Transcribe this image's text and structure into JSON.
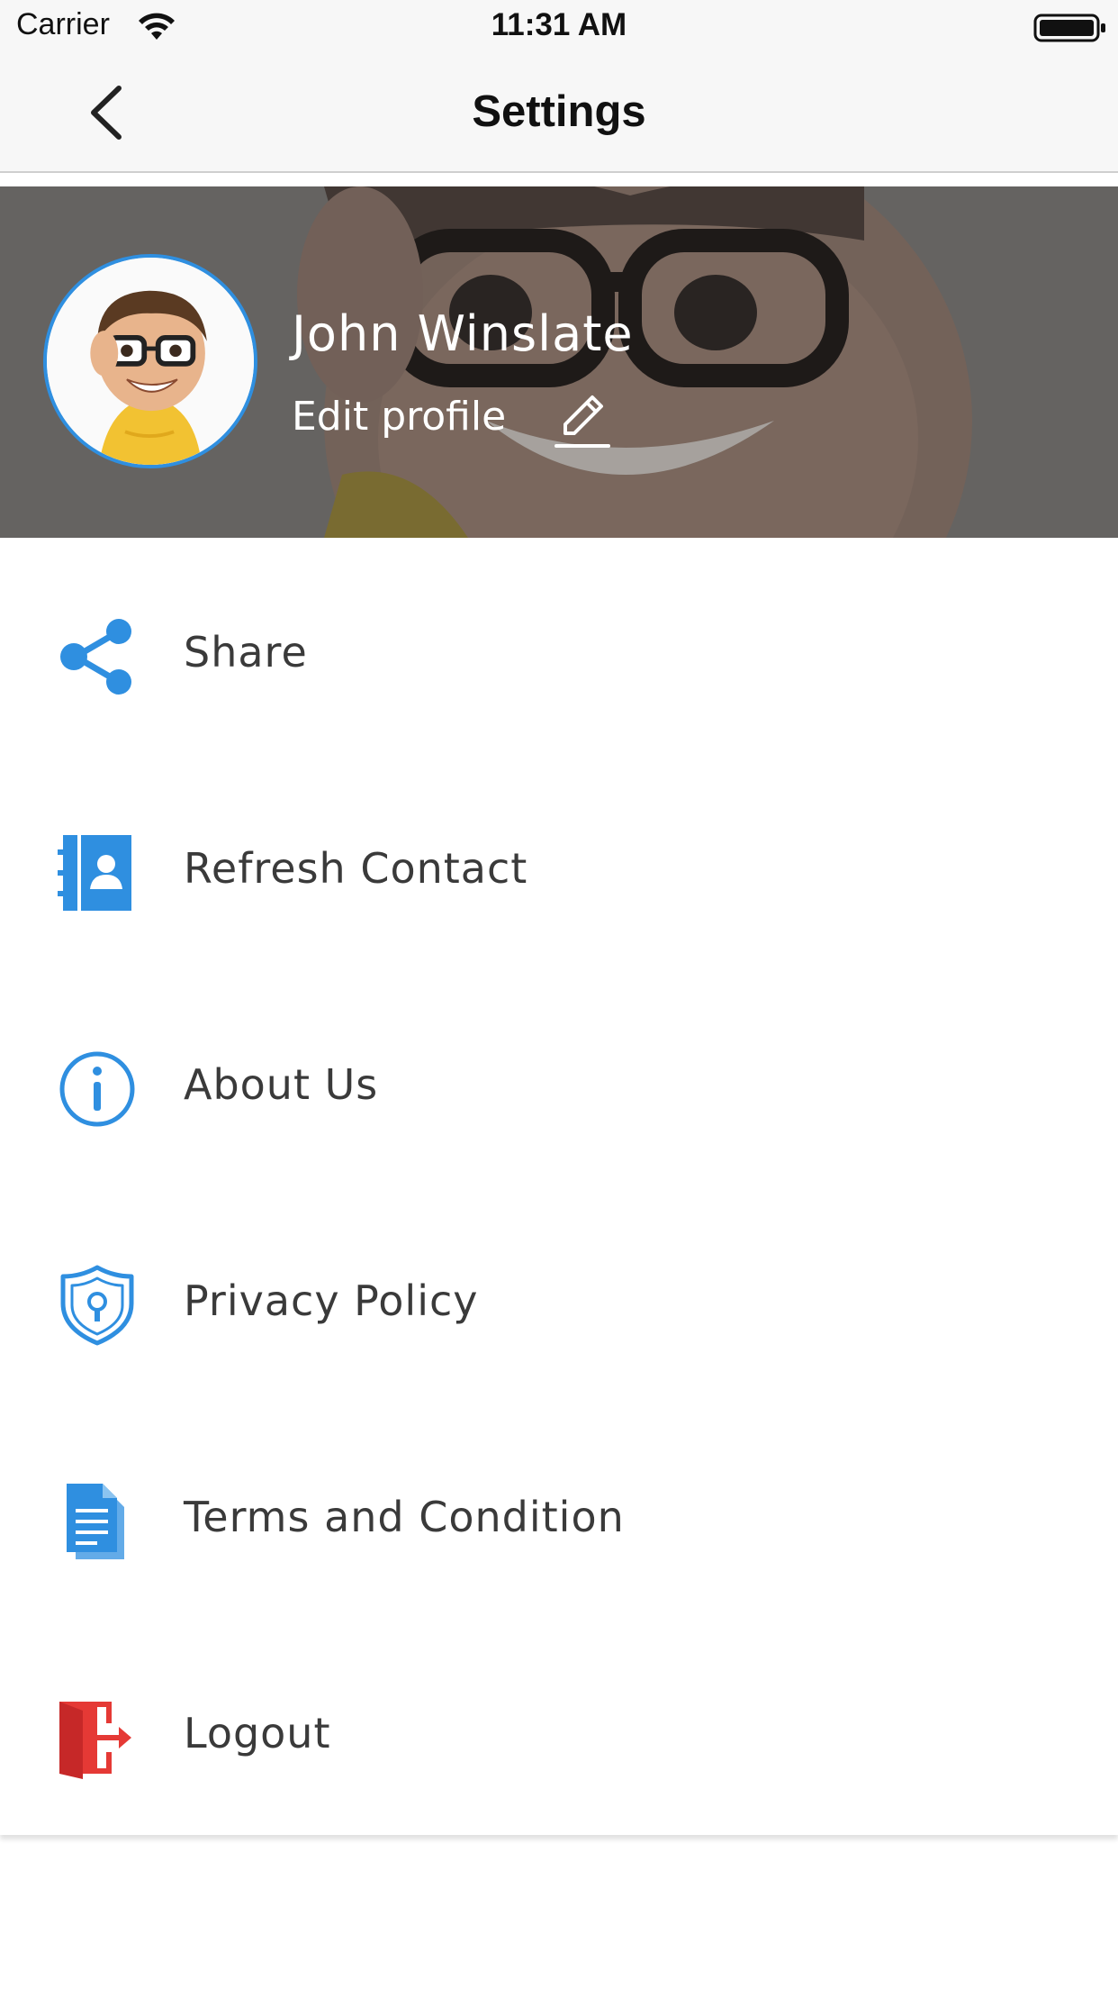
{
  "status_bar": {
    "carrier": "Carrier",
    "time": "11:31 AM"
  },
  "nav": {
    "title": "Settings"
  },
  "profile": {
    "name": "John Winslate",
    "edit_label": "Edit profile"
  },
  "menu": {
    "items": [
      {
        "label": "Share",
        "icon": "share-icon"
      },
      {
        "label": "Refresh Contact",
        "icon": "contact-book-icon"
      },
      {
        "label": "About Us",
        "icon": "info-icon"
      },
      {
        "label": "Privacy Policy",
        "icon": "shield-lock-icon"
      },
      {
        "label": "Terms and Condition",
        "icon": "document-icon"
      },
      {
        "label": "Logout",
        "icon": "logout-door-icon"
      }
    ]
  },
  "colors": {
    "accent": "#2f8fe0",
    "logout": "#e53935",
    "text": "#3a3a3a"
  }
}
